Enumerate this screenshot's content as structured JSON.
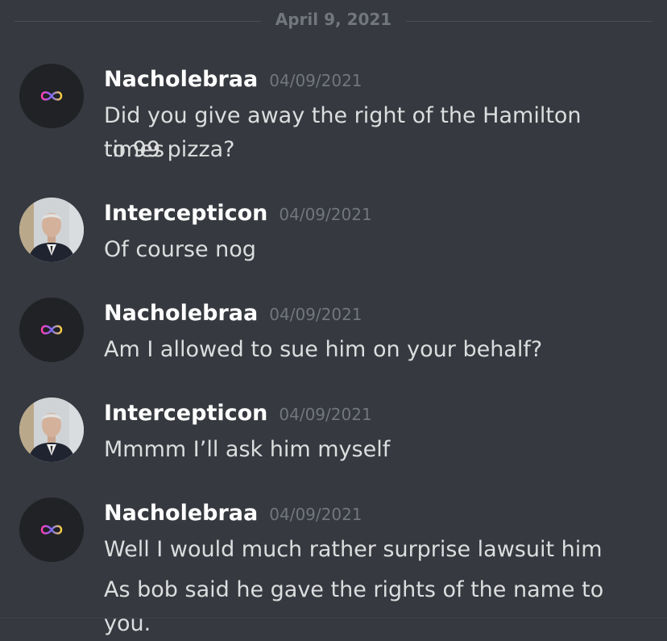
{
  "date_divider": "April 9, 2021",
  "messages": [
    {
      "username": "Nacholebraa",
      "timestamp": "04/09/2021",
      "avatar": "infinity-icon",
      "lines": [
        "Did you give away the right of the Hamilton times",
        "to 99  pizza?"
      ]
    },
    {
      "username": "Intercepticon",
      "timestamp": "04/09/2021",
      "avatar": "man-in-suit-photo",
      "lines": [
        "Of course nog"
      ]
    },
    {
      "username": "Nacholebraa",
      "timestamp": "04/09/2021",
      "avatar": "infinity-icon",
      "lines": [
        "Am I allowed to sue him on your behalf?"
      ]
    },
    {
      "username": "Intercepticon",
      "timestamp": "04/09/2021",
      "avatar": "man-in-suit-photo",
      "lines": [
        "Mmmm I’ll ask him myself"
      ]
    },
    {
      "username": "Nacholebraa",
      "timestamp": "04/09/2021",
      "avatar": "infinity-icon",
      "lines": [
        "Well I would much rather surprise lawsuit him",
        "As bob said he gave the rights of the name to you."
      ]
    }
  ],
  "colors": {
    "background": "#36393f",
    "username": "#ffffff",
    "timestamp": "#72767d",
    "message_text": "#dcddde"
  }
}
